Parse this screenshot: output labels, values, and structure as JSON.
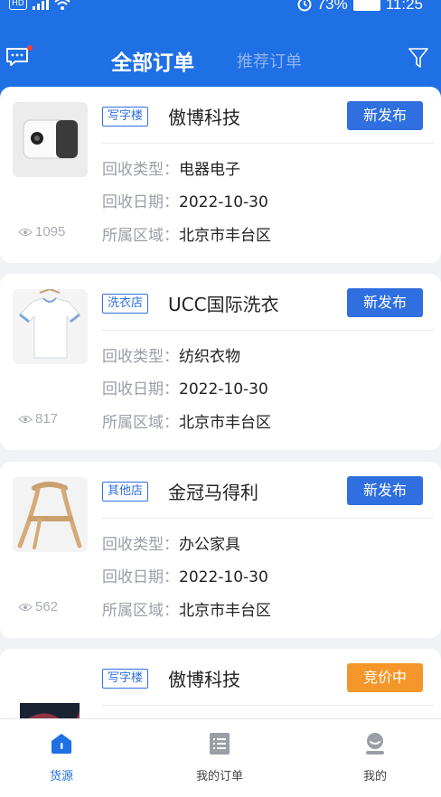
{
  "status_bar": {
    "left_badge": "HD",
    "battery": "73%",
    "time": "11:25"
  },
  "nav": {
    "tab_all": "全部订单",
    "tab_recommended": "推荐订单"
  },
  "labels": {
    "type": "回收类型：",
    "date": "回收日期：",
    "area": "所属区域："
  },
  "orders": [
    {
      "tag": "写字楼",
      "company": "傲博科技",
      "status": "新发布",
      "status_color": "#2f6fe0",
      "type": "电器电子",
      "date": "2022-10-30",
      "area": "北京市丰台区",
      "views": "1095",
      "image": "projector-image"
    },
    {
      "tag": "洗衣店",
      "company": "UCC国际洗衣",
      "status": "新发布",
      "status_color": "#2f6fe0",
      "type": "纺织衣物",
      "date": "2022-10-30",
      "area": "北京市丰台区",
      "views": "817",
      "image": "tshirt-image"
    },
    {
      "tag": "其他店",
      "company": "金冠马得利",
      "status": "新发布",
      "status_color": "#2f6fe0",
      "type": "办公家具",
      "date": "2022-10-30",
      "area": "北京市丰台区",
      "views": "562",
      "image": "chair-image"
    },
    {
      "tag": "写字楼",
      "company": "傲博科技",
      "status": "竞价中",
      "status_color": "#f5962a",
      "image": "laptop-image"
    }
  ],
  "tabbar": {
    "tab1": "货源",
    "tab2": "我的订单",
    "tab3": "我的"
  }
}
